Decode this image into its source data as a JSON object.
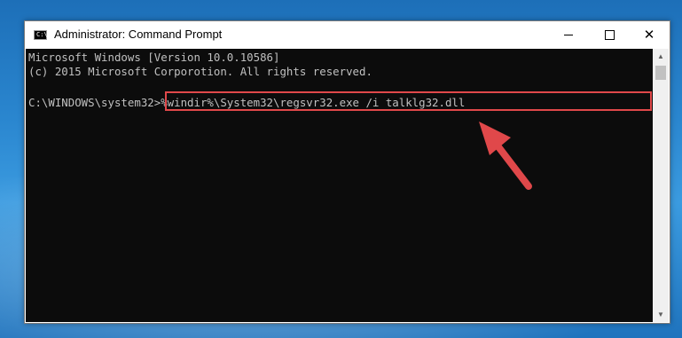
{
  "window": {
    "title": "Administrator: Command Prompt",
    "icon": "cmd-icon",
    "icon_glyph": "C:\\"
  },
  "controls": {
    "minimize_icon": "minimize-icon",
    "maximize_icon": "maximize-icon",
    "close_glyph": "✕"
  },
  "console": {
    "lines": [
      "Microsoft Windows [Version 10.0.10586]",
      "(c) 2015 Microsoft Corporotion. All rights reserved.",
      "C:\\WINDOWS\\system32>%windir%\\System32\\regsvr32.exe /i talklg32.dll"
    ],
    "text_color": "#c0c0c0",
    "background": "#0c0c0c"
  },
  "scrollbar": {
    "up_glyph": "▲",
    "down_glyph": "▼"
  },
  "annotation": {
    "highlight_color": "#e0484a",
    "arrow_icon": "red-arrow-icon"
  }
}
